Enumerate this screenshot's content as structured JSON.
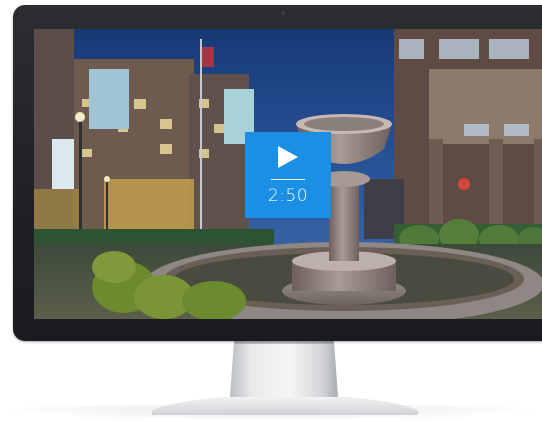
{
  "video": {
    "duration": "2:50",
    "play_icon": "play-icon"
  },
  "colors": {
    "play_button_bg": "#1a8fe3",
    "bezel": "#1f2124",
    "sky": "#1c3a6a"
  }
}
